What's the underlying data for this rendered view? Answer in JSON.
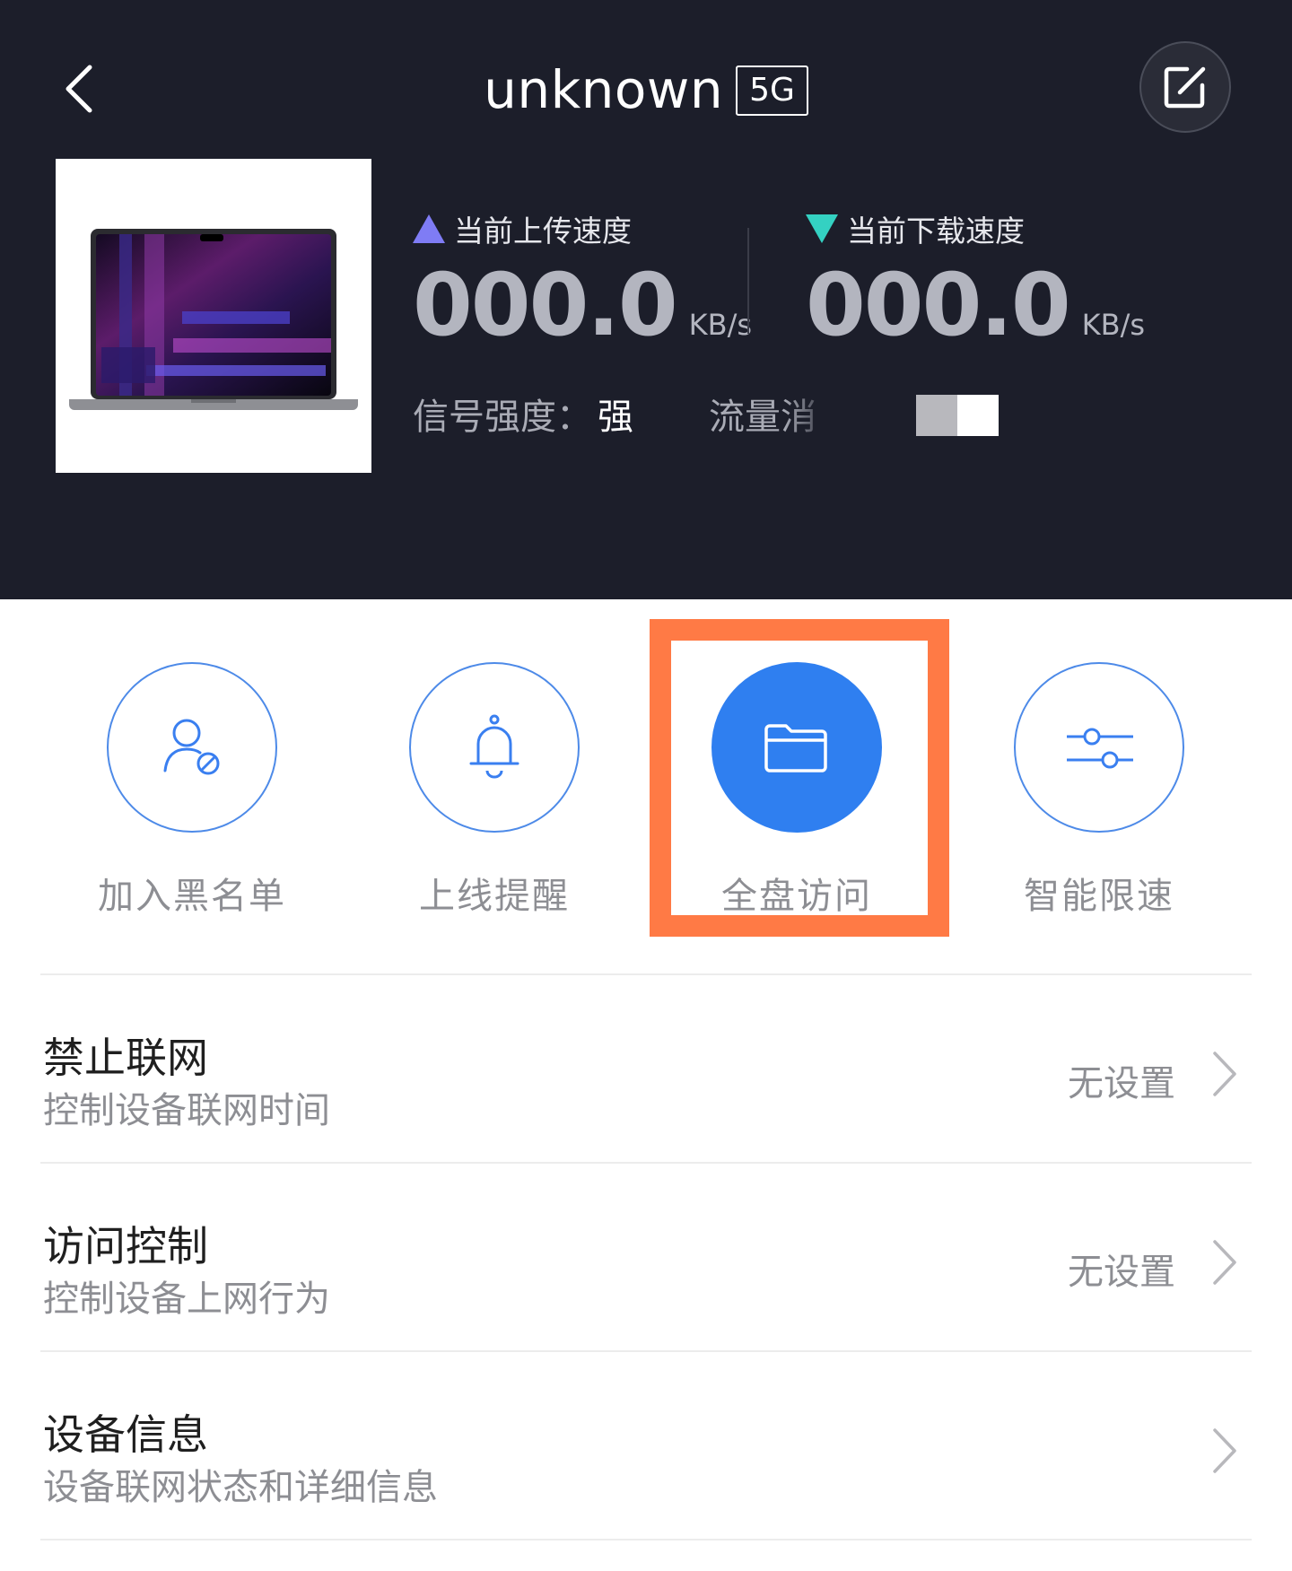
{
  "header": {
    "title": "unknown",
    "band_badge": "5G",
    "icons": {
      "back": "chevron-left-icon",
      "edit": "edit-icon"
    }
  },
  "stats": {
    "upload": {
      "label": "当前上传速度",
      "value": "000.0",
      "unit": "KB/s",
      "color": "#7f7cf5"
    },
    "download": {
      "label": "当前下载速度",
      "value": "000.0",
      "unit": "KB/s",
      "color": "#34d1c2"
    }
  },
  "signal": {
    "label": "信号强度：",
    "value": "强"
  },
  "traffic": {
    "label": "流量消"
  },
  "actions": [
    {
      "label": "加入黑名单",
      "icon": "user-block-icon"
    },
    {
      "label": "上线提醒",
      "icon": "bell-icon"
    },
    {
      "label": "全盘访问",
      "icon": "folder-icon",
      "active": true
    },
    {
      "label": "智能限速",
      "icon": "sliders-icon"
    }
  ],
  "list": [
    {
      "title": "禁止联网",
      "subtitle": "控制设备联网时间",
      "value": "无设置"
    },
    {
      "title": "访问控制",
      "subtitle": "控制设备上网行为",
      "value": "无设置"
    },
    {
      "title": "设备信息",
      "subtitle": "设备联网状态和详细信息",
      "value": ""
    }
  ],
  "colors": {
    "header_bg": "#1c1e2a",
    "accent": "#2f7ff0",
    "highlight": "#ff7a45"
  }
}
